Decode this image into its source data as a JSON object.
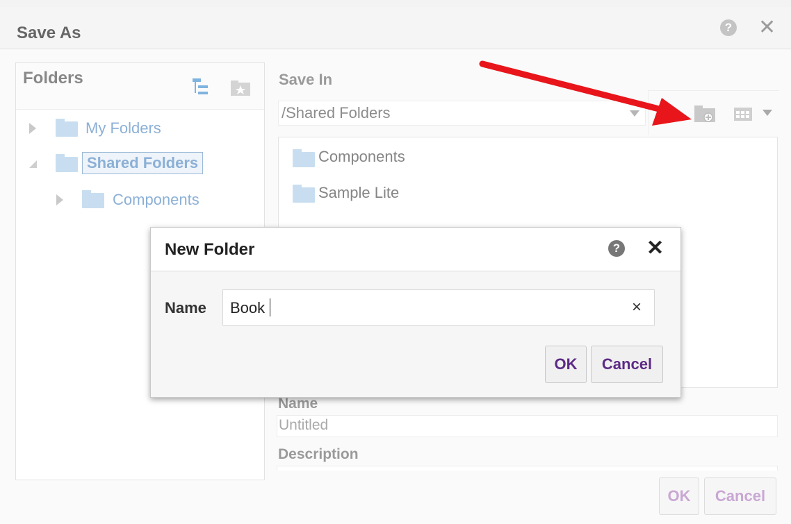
{
  "save_as": {
    "title": "Save As",
    "help_glyph": "?",
    "close_glyph": "✕",
    "folders": {
      "title": "Folders",
      "tree": [
        {
          "label": "My Folders",
          "expanded": false,
          "selected": false
        },
        {
          "label": "Shared Folders",
          "expanded": true,
          "selected": true
        },
        {
          "label": "Components",
          "expanded": false,
          "selected": false
        }
      ]
    },
    "save_in": {
      "label": "Save In",
      "value": "/Shared Folders"
    },
    "list_items": [
      "Components",
      "Sample Lite"
    ],
    "name": {
      "label": "Name",
      "value": "Untitled"
    },
    "description": {
      "label": "Description",
      "value": ""
    },
    "ok_label": "OK",
    "cancel_label": "Cancel"
  },
  "new_folder": {
    "title": "New Folder",
    "help_glyph": "?",
    "close_glyph": "✕",
    "name_label": "Name",
    "name_value": "Book",
    "clear_glyph": "×",
    "ok_label": "OK",
    "cancel_label": "Cancel"
  },
  "icons": {
    "tree_view": "tree-view-icon",
    "favorites": "favorite-folder-icon",
    "new_folder": "new-folder-icon",
    "view_menu": "grid-view-icon"
  },
  "colors": {
    "annotation_arrow": "#e8151b",
    "link_blue": "#8cb0d6",
    "button_text": "#5d2a86"
  }
}
